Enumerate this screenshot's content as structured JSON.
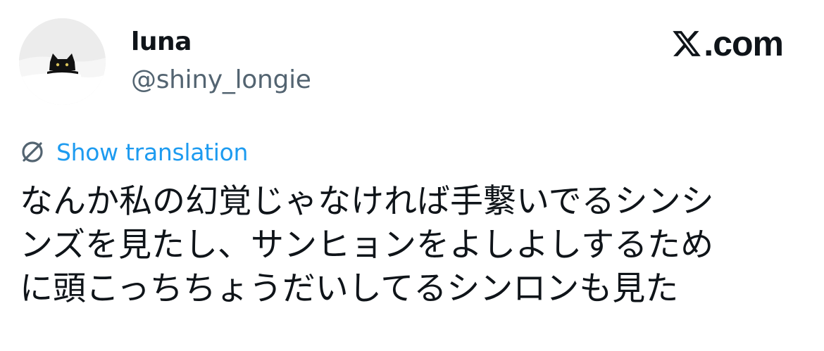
{
  "author": {
    "display_name": "luna",
    "handle": "@shiny_longie",
    "avatar_icon": "black-cat-avatar"
  },
  "brand": {
    "label": ".com",
    "icon": "x-logo-icon"
  },
  "translation": {
    "label": "Show translation",
    "icon": "globe-icon",
    "color": "#1d9bf0"
  },
  "tweet": {
    "lines": [
      "なんか私の幻覚じゃなければ手繋いでるシンシ",
      "ンズを見たし、サンヒョンをよしよしするため",
      "に頭こっちちょうだいしてるシンロンも見た"
    ]
  }
}
